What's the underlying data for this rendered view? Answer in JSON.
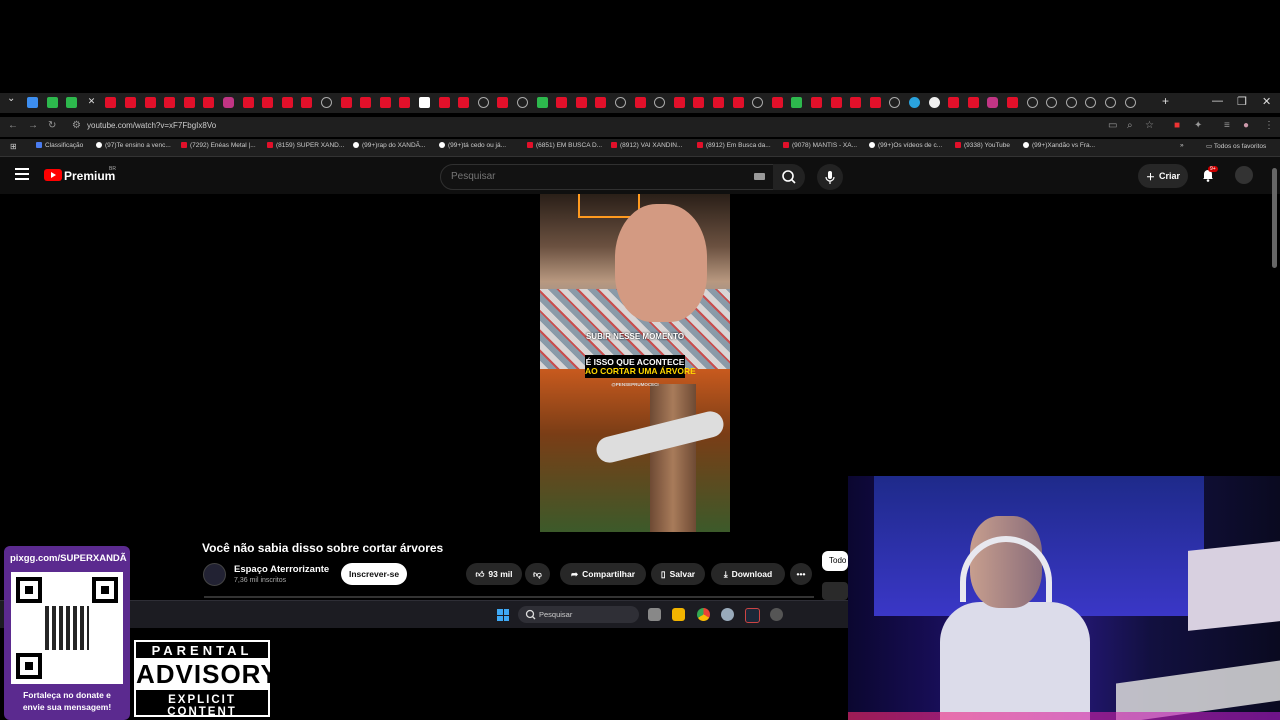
{
  "browser": {
    "url": "youtube.com/watch?v=xF7FbgIx8Vo",
    "bookmarks": [
      {
        "label": "Classificação",
        "kind": "cl"
      },
      {
        "label": "(97)Te ensino a venc...",
        "kind": "tt"
      },
      {
        "label": "(7292) Enéas Metal |...",
        "kind": "yt"
      },
      {
        "label": "(8159) SUPER XAND...",
        "kind": "yt"
      },
      {
        "label": "(99+)rap do XANDÃ...",
        "kind": "tt"
      },
      {
        "label": "(99+)tá cedo ou já...",
        "kind": "tt"
      },
      {
        "label": "(6851) EM BUSCA D...",
        "kind": "yt"
      },
      {
        "label": "(8912) VAI XANDIN...",
        "kind": "yt"
      },
      {
        "label": "(8912) Em Busca da...",
        "kind": "yt"
      },
      {
        "label": "(9078) MANTIS - XA...",
        "kind": "yt"
      },
      {
        "label": "(99+)Os vídeos de c...",
        "kind": "tt"
      },
      {
        "label": "(9338) YouTube",
        "kind": "yt"
      },
      {
        "label": "(99+)Xandão vs Fra...",
        "kind": "tt"
      }
    ],
    "all_favorites": "Todos os favoritos"
  },
  "youtube": {
    "logo_text": "Premium",
    "country": "BR",
    "search_placeholder": "Pesquisar",
    "create_label": "Criar",
    "notif_badge": "9+"
  },
  "video": {
    "caption_top": "SUBIR NESSE MOMENTO",
    "caption_line1": "É ISSO QUE ACONTECE",
    "caption_line2": "AO CORTAR UMA ÁRVORE",
    "caption_handle": "@PENSEPRUMOCECI",
    "title": "Você não sabia disso sobre cortar árvores",
    "channel": "Espaço Aterrorizante",
    "subscribers": "7,36 mil inscritos",
    "subscribe_label": "Inscrever-se",
    "likes": "93 mil",
    "share_label": "Compartilhar",
    "save_label": "Salvar",
    "download_label": "Download",
    "todos_label": "Todo"
  },
  "taskbar": {
    "search_label": "Pesquisar"
  },
  "overlay": {
    "pix_url": "pixgg.com/SUPERXANDÃ",
    "pix_msg1": "Fortaleça no donate e",
    "pix_msg2": "envie sua mensagem!",
    "advisory_line1": "PARENTAL",
    "advisory_line2": "ADVISORY",
    "advisory_line3": "EXPLICIT CONTENT"
  },
  "colors": {
    "youtube_red": "#ff0000",
    "background": "#000000",
    "pix_purple": "#5b2a8f"
  }
}
